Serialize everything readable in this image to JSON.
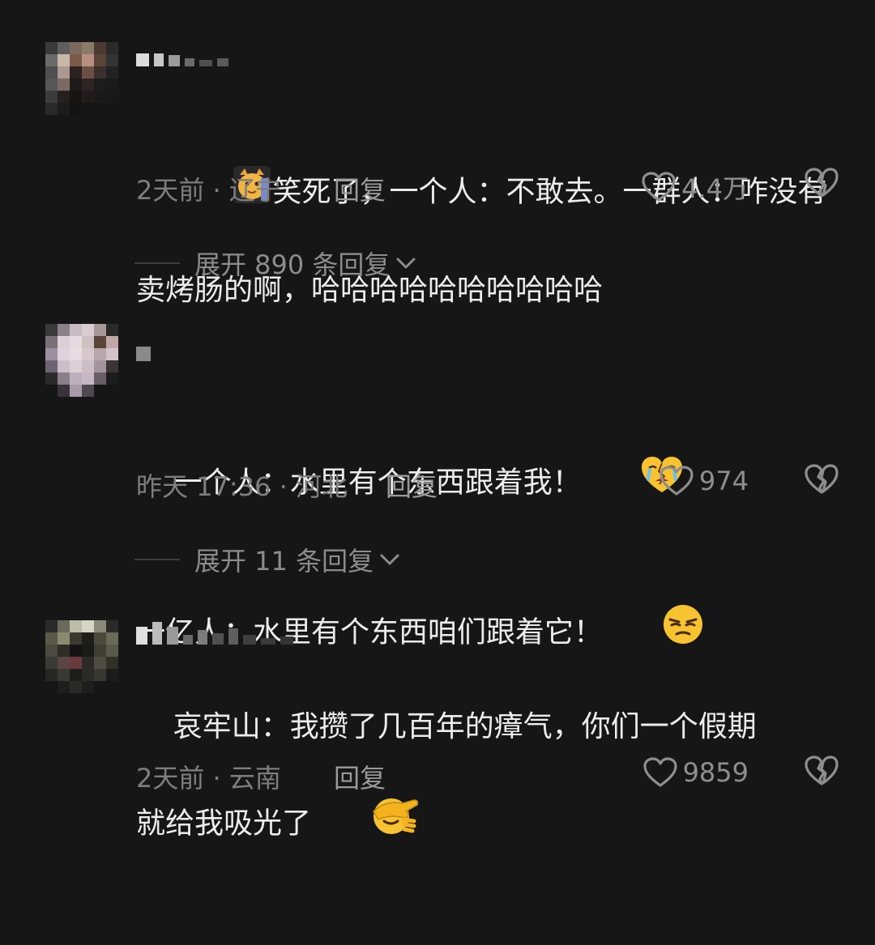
{
  "comments": [
    {
      "text_line1": "笑死了，一个人：不敢去。一群人：咋没有",
      "text_line2": "卖烤肠的啊，哈哈哈哈哈哈哈哈哈哈",
      "time_location": "2天前 · 辽宁",
      "reply_label": "回复",
      "likes": "4.4万",
      "expand_label": "展开 890 条回复",
      "avatar_icon": "pixelated-avatar",
      "inline_icon": "cat-sticker-icon"
    },
    {
      "text_line1": "一个人：水里有个东西跟着我！",
      "text_line2": "一亿人：水里有个东西咱们跟着它！",
      "time_location": "昨天 17:36 · 河北",
      "reply_label": "回复",
      "likes": "974",
      "expand_label": "展开 11 条回复",
      "avatar_icon": "pixelated-avatar",
      "line1_emoji": "heartbroken-crying-emoji",
      "line2_emoji": "smirk-emoji"
    },
    {
      "text_line1": "哀牢山：我攒了几百年的瘴气，你们一个假期",
      "text_line2": "就给我吸光了",
      "time_location": "2天前 · 云南",
      "reply_label": "回复",
      "likes": "9859",
      "avatar_icon": "pixelated-avatar",
      "line2_emoji": "facepalm-emoji"
    }
  ],
  "colors": {
    "background": "#161616",
    "text": "#ececec",
    "meta": "#7e7e7e",
    "emoji_yellow": "#f7c331"
  }
}
